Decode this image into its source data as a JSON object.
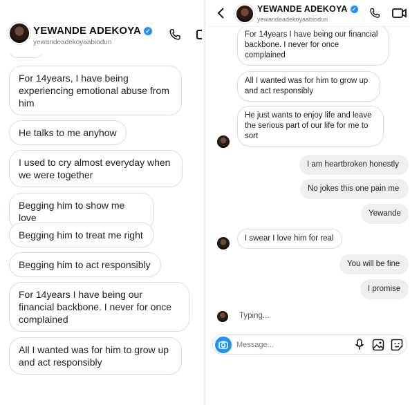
{
  "left": {
    "header": {
      "name": "YEWANDE ADEKOYA",
      "handle": "yewandeadekoyaabiodun"
    },
    "messages": [
      {
        "text": "For 14years, I have being experiencing emotional abuse from him"
      },
      {
        "text": "He talks to me anyhow"
      },
      {
        "text": "I used to cry almost everyday when we were together"
      },
      {
        "text": "Begging him to show me love"
      },
      {
        "text": "Begging him to treat me right"
      },
      {
        "text": "Begging him to act responsibly"
      },
      {
        "text": "For 14years I have being our financial backbone. I never for once complained"
      },
      {
        "text": "All I wanted was for him to grow up and act responsibly"
      }
    ]
  },
  "right": {
    "header": {
      "name": "YEWANDE ADEKOYA",
      "handle": "yewandeadekoyaabiodun"
    },
    "messages": [
      {
        "text": "For 14years I have being our financial backbone. I never for once complained",
        "dir": "in"
      },
      {
        "text": "All I wanted was for him to grow up and act responsibly",
        "dir": "in"
      },
      {
        "text": "He just wants to enjoy life and leave the serious part of our life for me to sort",
        "dir": "in"
      },
      {
        "text": "I am heartbroken honestly",
        "dir": "out"
      },
      {
        "text": "No jokes this one pain me",
        "dir": "out"
      },
      {
        "text": "Yewande",
        "dir": "out"
      },
      {
        "text": "I swear I love him for real",
        "dir": "in"
      },
      {
        "text": "You will be fine",
        "dir": "out"
      },
      {
        "text": "I promise",
        "dir": "out"
      }
    ],
    "typing": "Typing...",
    "composer": {
      "placeholder": "Message..."
    }
  },
  "icons": [
    "back-icon",
    "phone-icon",
    "video-icon",
    "verified-icon",
    "camera-icon",
    "microphone-icon",
    "gallery-icon",
    "sticker-icon",
    "chevron-left-icon"
  ],
  "colors": {
    "accent": "#1e90ff",
    "bubble_out": "#efefef",
    "bubble_border": "#dbdbdb"
  }
}
